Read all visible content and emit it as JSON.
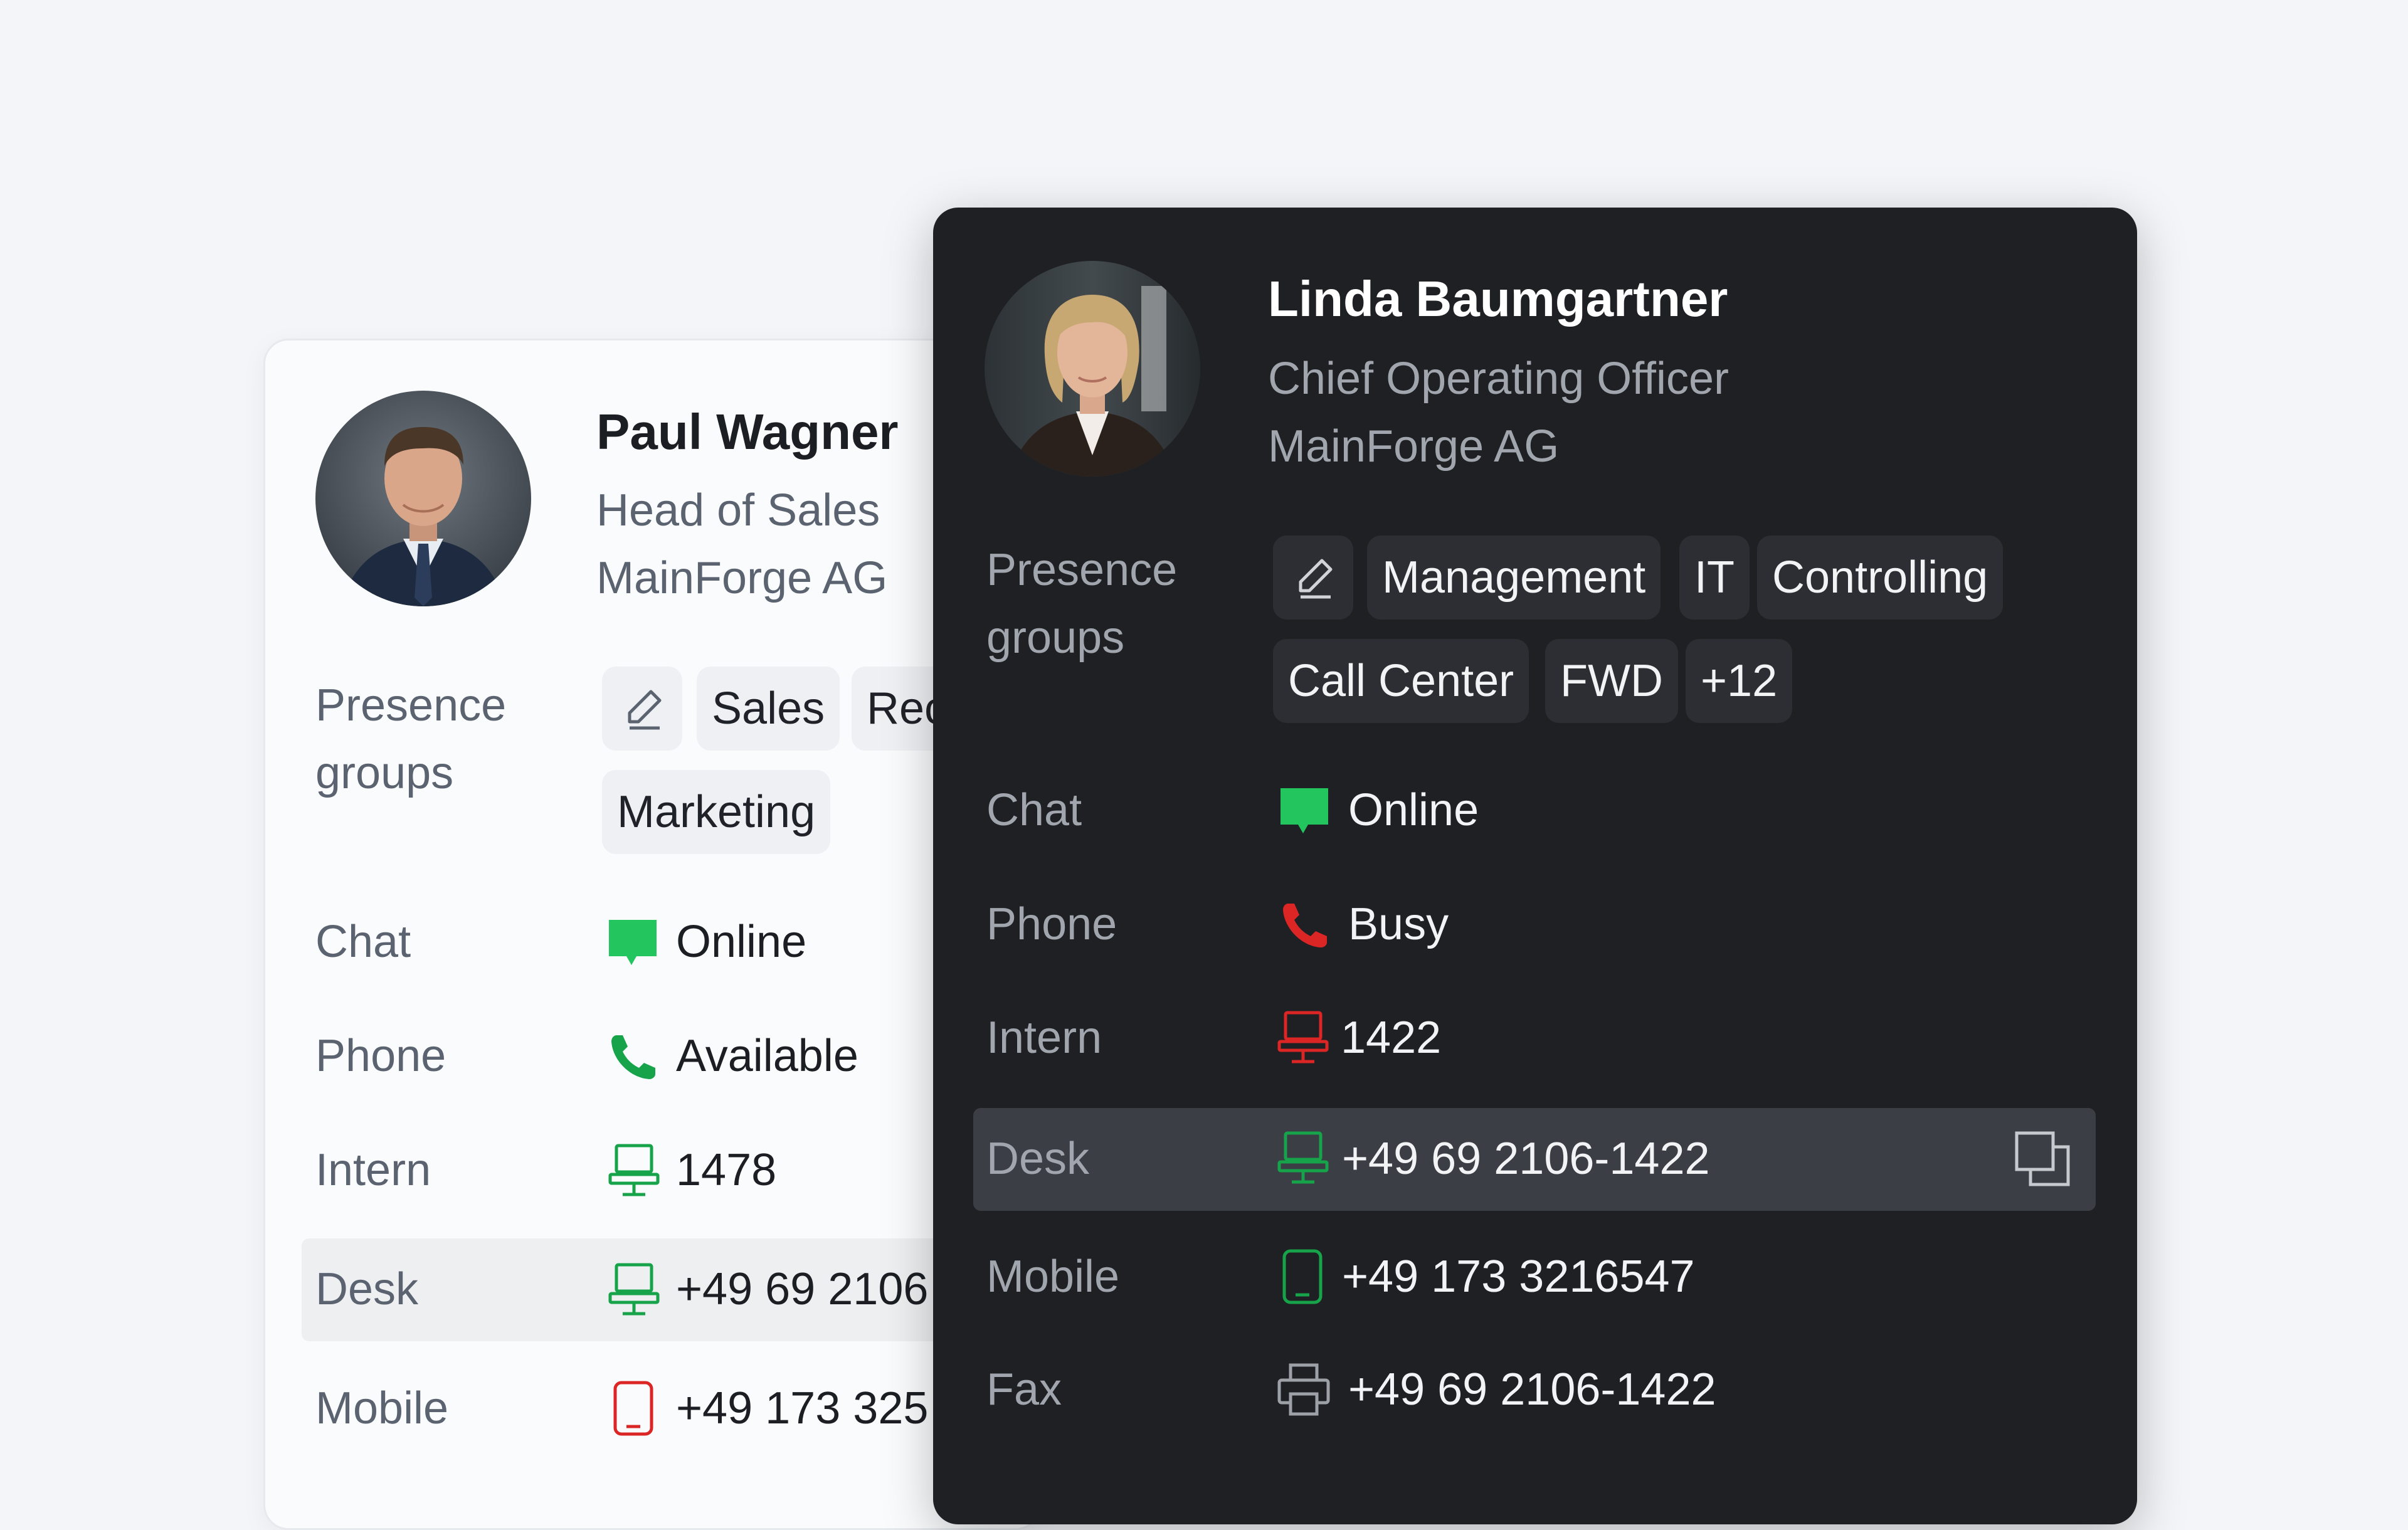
{
  "colors": {
    "online_green": "#22c55e",
    "busy_red": "#dc2626",
    "dark_card_bg": "#1f2023",
    "light_card_bg": "#fafbfc"
  },
  "back_card": {
    "avatar": "avatar-photo",
    "name": "Paul Wagner",
    "title": "Head of Sales",
    "company": "MainForge AG",
    "presence_label_line1": "Presence",
    "presence_label_line2": "groups",
    "edit_icon": "pencil-icon",
    "groups": [
      "Sales",
      "Rec",
      "Marketing"
    ],
    "rows": {
      "chat": {
        "label": "Chat",
        "value": "Online",
        "icon": "chat-bubble-icon",
        "status": "online"
      },
      "phone": {
        "label": "Phone",
        "value": "Available",
        "icon": "phone-icon",
        "status": "available"
      },
      "intern": {
        "label": "Intern",
        "value": "1478",
        "icon": "desk-phone-icon",
        "status": "available"
      },
      "desk": {
        "label": "Desk",
        "value": "+49 69 2106",
        "icon": "desk-phone-icon",
        "status": "available"
      },
      "mobile": {
        "label": "Mobile",
        "value": "+49 173 325",
        "icon": "mobile-icon",
        "status": "busy"
      }
    }
  },
  "front_card": {
    "avatar": "avatar-photo",
    "name": "Linda Baumgartner",
    "title": "Chief Operating Officer",
    "company": "MainForge AG",
    "presence_label_line1": "Presence",
    "presence_label_line2": "groups",
    "edit_icon": "pencil-icon",
    "groups": [
      "Management",
      "IT",
      "Controlling",
      "Call Center",
      "FWD",
      "+12"
    ],
    "rows": {
      "chat": {
        "label": "Chat",
        "value": "Online",
        "icon": "chat-bubble-icon",
        "status": "online"
      },
      "phone": {
        "label": "Phone",
        "value": "Busy",
        "icon": "phone-icon",
        "status": "busy"
      },
      "intern": {
        "label": "Intern",
        "value": "1422",
        "icon": "desk-phone-icon",
        "status": "busy"
      },
      "desk": {
        "label": "Desk",
        "value": "+49 69 2106-1422",
        "icon": "desk-phone-icon",
        "status": "available",
        "action_icon": "copy-icon"
      },
      "mobile": {
        "label": "Mobile",
        "value": "+49 173 3216547",
        "icon": "mobile-icon",
        "status": "available"
      },
      "fax": {
        "label": "Fax",
        "value": "+49 69 2106-1422",
        "icon": "printer-icon",
        "status": "neutral"
      }
    }
  }
}
